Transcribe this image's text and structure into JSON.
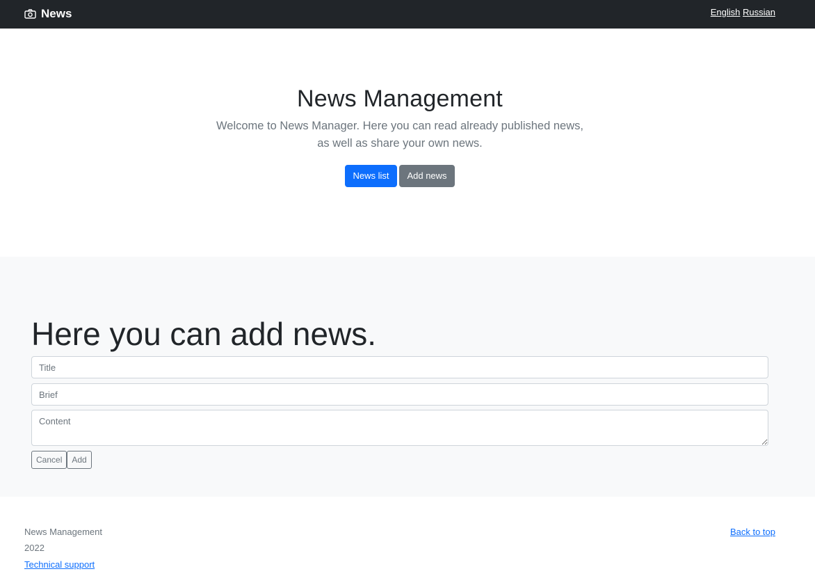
{
  "navbar": {
    "brand": "News",
    "brand_icon": "camera-icon",
    "languages": [
      "English",
      "Russian"
    ]
  },
  "hero": {
    "title": "News Management",
    "lead": "Welcome to News Manager. Here you can read already published news, as well as share your own news.",
    "buttons": {
      "news_list": "News list",
      "add_news": "Add news"
    }
  },
  "add_form": {
    "heading": "Here you can add news.",
    "title_placeholder": "Title",
    "brief_placeholder": "Brief",
    "content_placeholder": "Content",
    "cancel_label": "Cancel",
    "add_label": "Add"
  },
  "footer": {
    "name": "News Management",
    "year": "2022",
    "support_link": "Technical support",
    "back_to_top": "Back to top"
  },
  "colors": {
    "navbar_bg": "#212529",
    "primary": "#0d6efd",
    "secondary": "#6c757d",
    "section_bg": "#f8f9fa"
  }
}
